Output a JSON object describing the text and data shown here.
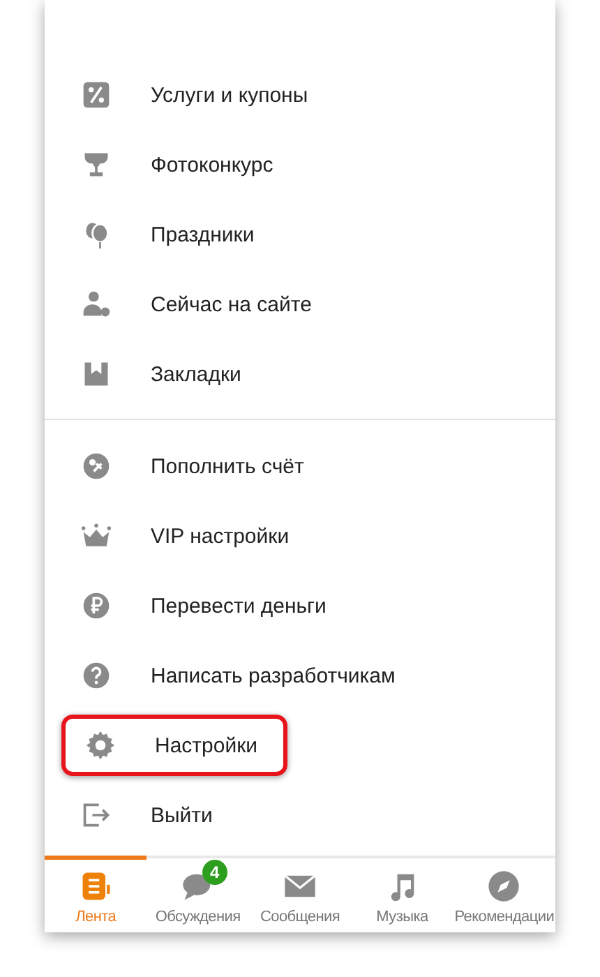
{
  "menu_sections": [
    {
      "items": [
        {
          "label": "Услуги и купоны",
          "highlighted": false
        },
        {
          "label": "Фотоконкурс",
          "highlighted": false
        },
        {
          "label": "Праздники",
          "highlighted": false
        },
        {
          "label": "Сейчас на сайте",
          "highlighted": false
        },
        {
          "label": "Закладки",
          "highlighted": false
        }
      ]
    },
    {
      "items": [
        {
          "label": "Пополнить счёт",
          "highlighted": false
        },
        {
          "label": "VIP настройки",
          "highlighted": false
        },
        {
          "label": "Перевести деньги",
          "highlighted": false
        },
        {
          "label": "Написать разработчикам",
          "highlighted": false
        },
        {
          "label": "Настройки",
          "highlighted": true
        },
        {
          "label": "Выйти",
          "highlighted": false
        }
      ]
    }
  ],
  "bottom_nav": [
    {
      "label": "Лента",
      "selected": true
    },
    {
      "label": "Обсуждения",
      "selected": false,
      "badge": "4"
    },
    {
      "label": "Сообщения",
      "selected": false
    },
    {
      "label": "Музыка",
      "selected": false
    },
    {
      "label": "Рекомендации",
      "selected": false
    }
  ]
}
